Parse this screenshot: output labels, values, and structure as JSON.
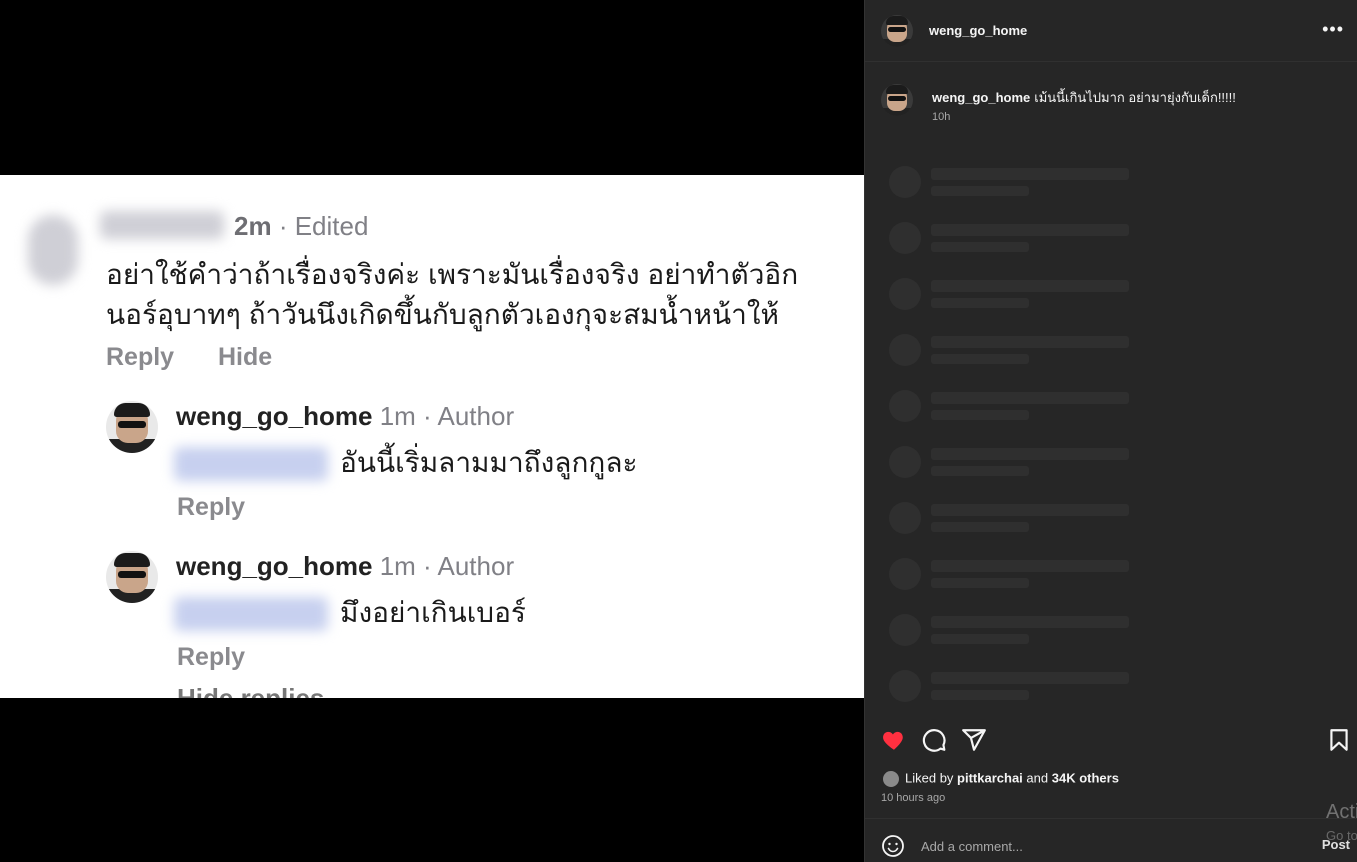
{
  "media": {
    "comment1": {
      "meta_time": "2m",
      "meta_rest": "· Edited",
      "text_line1": "อย่าใช้คำว่าถ้าเรื่องจริงค่ะ เพราะมันเรื่องจริง อย่าทำตัวอิก",
      "text_line2": "นอร์อุบาทๆ ถ้าวันนึงเกิดขึ้นกับลูกตัวเองกุจะสมน้ำหน้าให้",
      "reply_label": "Reply",
      "hide_label": "Hide"
    },
    "reply1": {
      "username": "weng_go_home",
      "meta_rest": "1m · Author",
      "text": "อันนี้เริ่มลามมาถึงลูกกูละ",
      "reply_label": "Reply"
    },
    "reply2": {
      "username": "weng_go_home",
      "meta_rest": "1m · Author",
      "text": "มึงอย่าเกินเบอร์",
      "reply_label": "Reply"
    },
    "cut_text": "Hide replies"
  },
  "sidebar": {
    "header_username": "weng_go_home",
    "more_icon": "more-horizontal-icon",
    "caption_username": "weng_go_home",
    "caption_text": "เม้นนี้เกินไปมาก อย่ามายุ่งกับเด็ก!!!!!",
    "caption_time": "10h",
    "actions": {
      "like_icon": "heart-filled-icon",
      "like_color": "#ff3040",
      "comment_icon": "comment-icon",
      "share_icon": "share-icon",
      "save_icon": "bookmark-icon"
    },
    "likes_prefix": "Liked by",
    "likes_user": "pittkarchai",
    "likes_and": "and",
    "likes_others": "34K others",
    "time_ago": "10 hours ago",
    "comment_placeholder": "Add a comment...",
    "post_label": "Post",
    "watermark_line1": "Acti",
    "watermark_line2": "Go to"
  }
}
